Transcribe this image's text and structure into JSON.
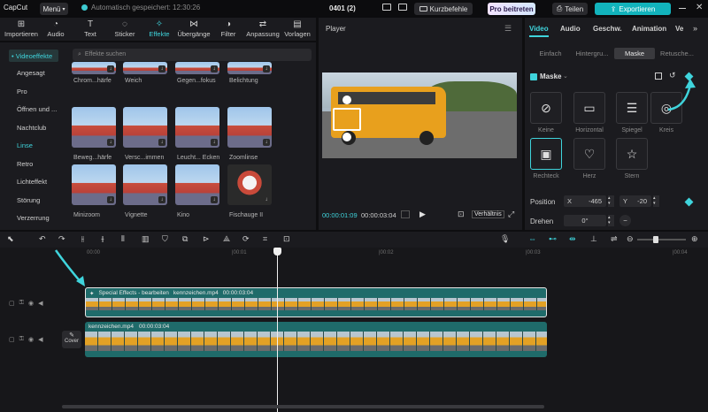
{
  "topbar": {
    "logo": "CapCut",
    "menu_label": "Menü",
    "autosave_text": "Automatisch gespeichert: 12:30:26",
    "project_title": "0401 (2)",
    "shortcuts_label": "Kurzbefehle",
    "pro_label": "Pro beitreten",
    "share_label": "Teilen",
    "export_label": "Exportieren"
  },
  "toolbar": {
    "tools": [
      {
        "label": "Importieren",
        "icon": "import-icon"
      },
      {
        "label": "Audio",
        "icon": "audio-icon"
      },
      {
        "label": "Text",
        "icon": "text-icon"
      },
      {
        "label": "Sticker",
        "icon": "sticker-icon"
      },
      {
        "label": "Effekte",
        "icon": "effects-icon",
        "active": true
      },
      {
        "label": "Übergänge",
        "icon": "transitions-icon"
      },
      {
        "label": "Filter",
        "icon": "filter-icon"
      },
      {
        "label": "Anpassung",
        "icon": "adjust-icon"
      },
      {
        "label": "Vorlagen",
        "icon": "templates-icon"
      }
    ]
  },
  "sidebar": {
    "selected": "• Videoeffekte",
    "items": [
      "Angesagt",
      "Pro",
      "Öffnen und ...",
      "Nachtclub",
      "Linse",
      "Retro",
      "Lichteffekt",
      "Störung",
      "Verzerrung"
    ],
    "active_item": "Linse"
  },
  "effects": {
    "search_placeholder": "Effekte suchen",
    "grid_labels": [
      "Chrom...härfe",
      "Weich",
      "Gegen...fokus",
      "Belichtung",
      "Beweg...härfe",
      "Versc...immen",
      "Leucht... Ecken",
      "Zoomlinse",
      "Minizoom",
      "Vignette",
      "Kino",
      "Fischauge II"
    ]
  },
  "player": {
    "title": "Player",
    "current_time": "00:00:01:09",
    "total_time": "00:00:03:04",
    "ratio_label": "Verhältnis"
  },
  "inspector": {
    "tabs": [
      "Video",
      "Audio",
      "Geschw.",
      "Animation",
      "Ve"
    ],
    "subtabs": [
      "Einfach",
      "Hintergru...",
      "Maske",
      "Retusche..."
    ],
    "active_subtab": "Maske",
    "section_title": "Maske",
    "masks": [
      {
        "label": "Keine",
        "icon": "none-mask-icon"
      },
      {
        "label": "Horizontal",
        "icon": "horizontal-mask-icon"
      },
      {
        "label": "Spiegel",
        "icon": "mirror-mask-icon"
      },
      {
        "label": "Kreis",
        "icon": "circle-mask-icon"
      },
      {
        "label": "Rechteck",
        "icon": "rectangle-mask-icon",
        "selected": true
      },
      {
        "label": "Herz",
        "icon": "heart-mask-icon"
      },
      {
        "label": "Stern",
        "icon": "star-mask-icon"
      }
    ],
    "position_label": "Position",
    "pos_x_label": "X",
    "pos_x_value": "-465",
    "pos_y_label": "Y",
    "pos_y_value": "-20",
    "rotate_label": "Drehen",
    "rotate_value": "0°"
  },
  "timeline": {
    "ticks": [
      "00:00",
      "|00:01",
      "|00:02",
      "|00:03",
      "|00:04"
    ],
    "effect_clip_label": "Special Effects - bearbeiten",
    "clip1_name": "kennzeichen.mp4",
    "clip1_duration": "00:00:03:04",
    "clip2_name": "kennzeichen.mp4",
    "clip2_duration": "00:00:03:04",
    "cover_label": "Cover"
  },
  "colors": {
    "accent": "#3fd4dc",
    "clip_teal": "#1f6b6a",
    "panel_bg": "#1b1b1f"
  }
}
